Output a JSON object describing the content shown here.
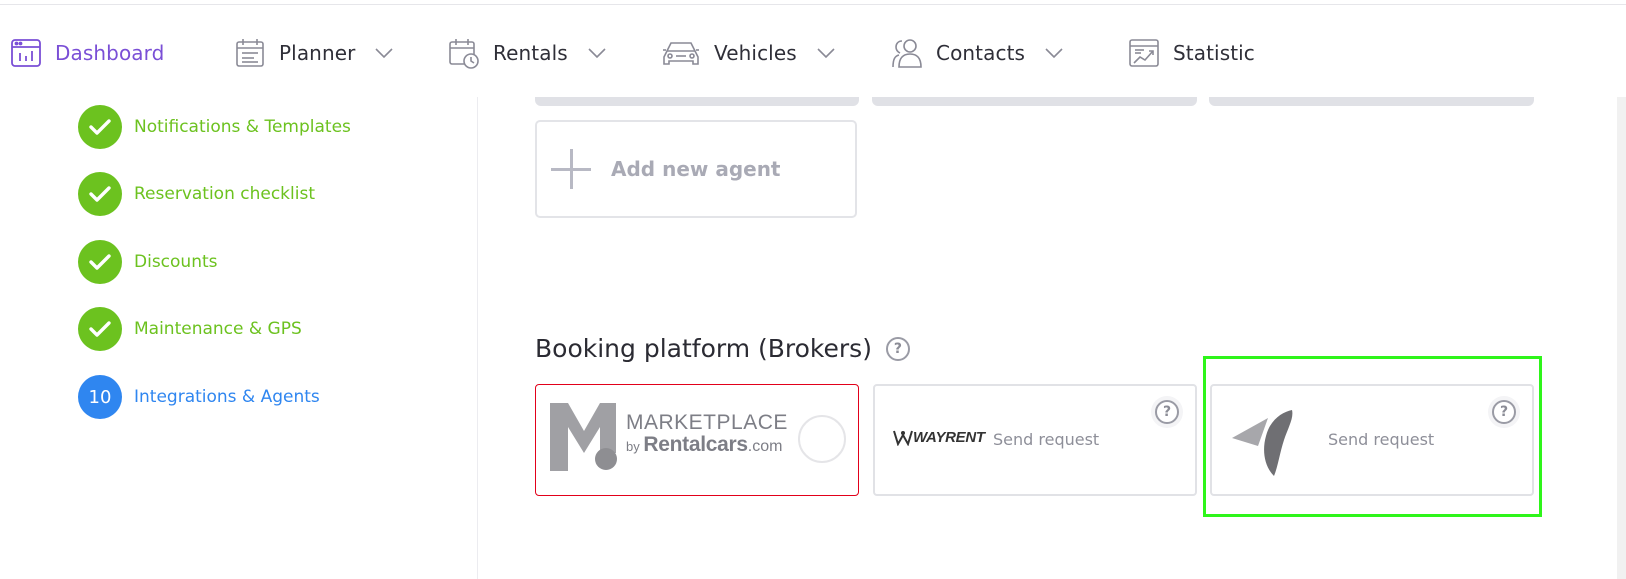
{
  "nav": {
    "items": [
      {
        "label": "Dashboard",
        "icon": "dashboard-icon",
        "active": true,
        "has_chevron": false
      },
      {
        "label": "Planner",
        "icon": "planner-icon",
        "active": false,
        "has_chevron": true
      },
      {
        "label": "Rentals",
        "icon": "rentals-calendar-clock-icon",
        "active": false,
        "has_chevron": true
      },
      {
        "label": "Vehicles",
        "icon": "car-icon",
        "active": false,
        "has_chevron": true
      },
      {
        "label": "Contacts",
        "icon": "contacts-icon",
        "active": false,
        "has_chevron": true
      },
      {
        "label": "Statistic",
        "icon": "statistic-chart-icon",
        "active": false,
        "has_chevron": false
      }
    ]
  },
  "sidebar": {
    "steps": [
      {
        "label": "Notifications & Templates",
        "state": "done"
      },
      {
        "label": "Reservation checklist",
        "state": "done"
      },
      {
        "label": "Discounts",
        "state": "done"
      },
      {
        "label": "Maintenance & GPS",
        "state": "done"
      },
      {
        "label": "Integrations & Agents",
        "state": "current",
        "number": "10"
      }
    ]
  },
  "agents": {
    "add_label": "Add new agent"
  },
  "brokers": {
    "title": "Booking platform (Brokers)",
    "help_glyph": "?",
    "cards": [
      {
        "name": "marketplace",
        "logo_lines": [
          "MARKETPLACE",
          "by",
          "Rentalcars",
          ".com"
        ],
        "action": ""
      },
      {
        "name": "wayrent",
        "logo_text": "WAYRENT",
        "action": "Send request"
      },
      {
        "name": "paper-plane-broker",
        "action": "Send request"
      }
    ]
  },
  "colors": {
    "accent_purple": "#7a4fd6",
    "success_green": "#6cc21f",
    "current_blue": "#2f86f0",
    "marketplace_border": "#e2001a",
    "highlight_green": "#2ef51a"
  }
}
